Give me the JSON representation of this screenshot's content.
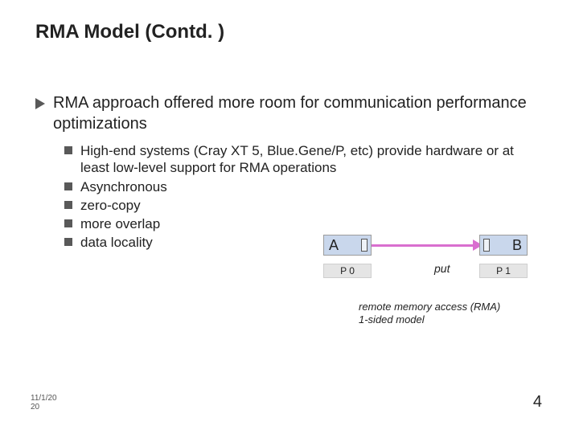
{
  "title": "RMA Model (Contd. )",
  "bullets": {
    "l1": "RMA approach offered more room for communication performance optimizations",
    "l2": [
      "High-end systems (Cray XT 5, Blue.Gene/P, etc) provide hardware or at least low-level support for RMA operations",
      "Asynchronous",
      "zero-copy",
      "more overlap",
      "data locality"
    ]
  },
  "diagram": {
    "boxA": "A",
    "boxB": "B",
    "p0": "P 0",
    "p1": "P 1",
    "opLabel": "put"
  },
  "caption": {
    "line1": "remote memory access (RMA)",
    "line2": "1-sided model"
  },
  "footer": {
    "date_line1": "11/1/20",
    "date_line2": "20",
    "page": "4"
  }
}
